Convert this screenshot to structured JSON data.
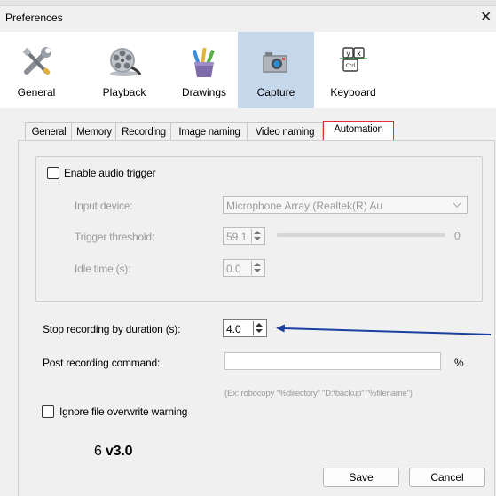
{
  "window": {
    "title": "Preferences",
    "close_glyph": "✕"
  },
  "toolbar": {
    "items": [
      {
        "label": "General",
        "icon": "tools-icon"
      },
      {
        "label": "Playback",
        "icon": "film-reel-icon"
      },
      {
        "label": "Drawings",
        "icon": "pencil-cup-icon"
      },
      {
        "label": "Capture",
        "icon": "camera-icon",
        "selected": true
      },
      {
        "label": "Keyboard",
        "icon": "keyboard-keys-icon"
      }
    ],
    "selected_color": "#c5d7ea"
  },
  "tabs": {
    "items": [
      "General",
      "Memory",
      "Recording",
      "Image naming",
      "Video naming",
      "Automation"
    ],
    "selected": "Automation",
    "highlight_color": "#e03030"
  },
  "audio_trigger": {
    "enable_label": "Enable audio trigger",
    "input_device_label": "Input device:",
    "input_device_value": "Microphone Array (Realtek(R) Au",
    "threshold_label": "Trigger threshold:",
    "threshold_value": "59.1",
    "threshold_slider_value": "0",
    "idle_label": "Idle time (s):",
    "idle_value": "0.0"
  },
  "stop_duration": {
    "label": "Stop recording by duration (s):",
    "value": "4.0"
  },
  "post_command": {
    "label": "Post recording command:",
    "value": "",
    "suffix": "%",
    "hint": "(Ex: robocopy \"%directory\" \"D:\\backup\" \"%filename\")"
  },
  "ignore_overwrite": {
    "label": "Ignore file overwrite warning"
  },
  "annotation": {
    "text_prefix": "6 ",
    "text_version": "v3.0",
    "arrow_color": "#1a3f9e"
  },
  "buttons": {
    "save": "Save",
    "cancel": "Cancel"
  }
}
